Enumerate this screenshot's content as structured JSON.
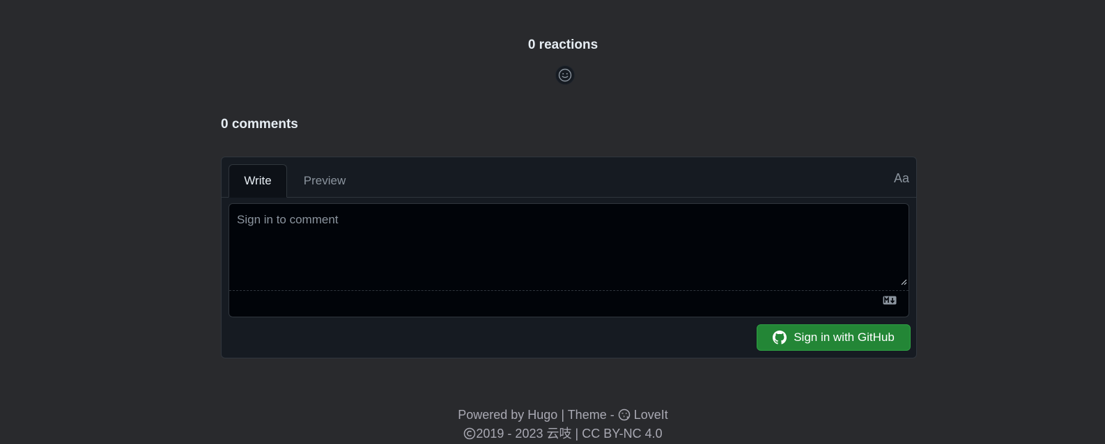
{
  "reactions": {
    "title": "0 reactions",
    "add_reaction_icon": "smiley-icon"
  },
  "comments": {
    "title": "0 comments",
    "tabs": [
      {
        "label": "Write",
        "active": true
      },
      {
        "label": "Preview",
        "active": false
      }
    ],
    "format_toggle_label": "Aa",
    "editor": {
      "placeholder": "Sign in to comment",
      "markdown_icon": "markdown-icon"
    },
    "signin_button": {
      "label": "Sign in with GitHub",
      "icon": "github-icon",
      "color": "#238636"
    }
  },
  "footer": {
    "powered_by": "Powered by",
    "hugo": "Hugo",
    "sep1": "|",
    "theme_prefix": "Theme -",
    "theme_name": "LoveIt",
    "copyright_years": "2019 - 2023",
    "author": "云吱",
    "sep2": "|",
    "license": "CC BY-NC 4.0"
  },
  "colors": {
    "background": "#292a2d",
    "panel": "#161b22",
    "editor": "#010409",
    "border": "#30363d",
    "muted_text": "#8b949e",
    "footer_text": "#a9a9b3"
  }
}
